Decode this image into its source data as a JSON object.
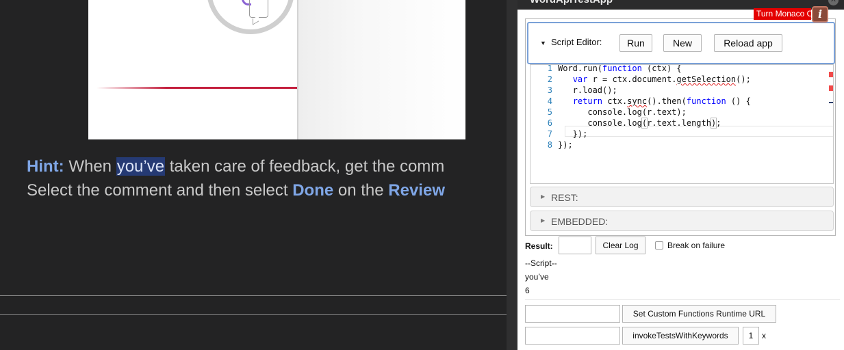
{
  "document": {
    "hint_line1_prefix": "Hint:",
    "hint_line1_pre": " When ",
    "hint_line1_selected": "you’ve",
    "hint_line1_post": " taken care of feedback, get the comm",
    "hint_line2_pre": "Select the comment and then select ",
    "hint_line2_done": "Done",
    "hint_line2_mid": " on the ",
    "hint_line2_review": "Review"
  },
  "pane": {
    "title": "WordApiTestApp",
    "close_glyph": "✕",
    "monaco_toggle": "Turn Monaco Off",
    "info_glyph": "i"
  },
  "script_editor": {
    "label": "Script Editor:",
    "collapse_glyph": "▼",
    "run_label": "Run",
    "new_label": "New",
    "reload_label": "Reload app"
  },
  "code_lines": [
    {
      "n": "1",
      "text": "Word.run(function (ctx) {"
    },
    {
      "n": "2",
      "text": "   var r = ctx.document.getSelection();"
    },
    {
      "n": "3",
      "text": "   r.load();"
    },
    {
      "n": "4",
      "text": "   return ctx.sync().then(function () {"
    },
    {
      "n": "5",
      "text": "      console.log(r.text);"
    },
    {
      "n": "6",
      "text": "      console.log(r.text.length);"
    },
    {
      "n": "7",
      "text": "   });"
    },
    {
      "n": "8",
      "text": "});"
    }
  ],
  "sections": {
    "rest_label": "REST:",
    "embedded_label": "EMBEDDED:",
    "expand_glyph": "▶"
  },
  "result": {
    "label": "Result:",
    "input_value": "",
    "clear_log_label": "Clear Log",
    "break_on_failure_label": "Break on failure",
    "break_on_failure_checked": false
  },
  "log": [
    "--Script--",
    "you’ve",
    "6"
  ],
  "runtime": {
    "url_input_value": "",
    "set_url_label": "Set Custom Functions Runtime URL",
    "keywords_input_value": "",
    "invoke_label": "invokeTestsWithKeywords",
    "count_value": "1",
    "times_label": "x"
  }
}
